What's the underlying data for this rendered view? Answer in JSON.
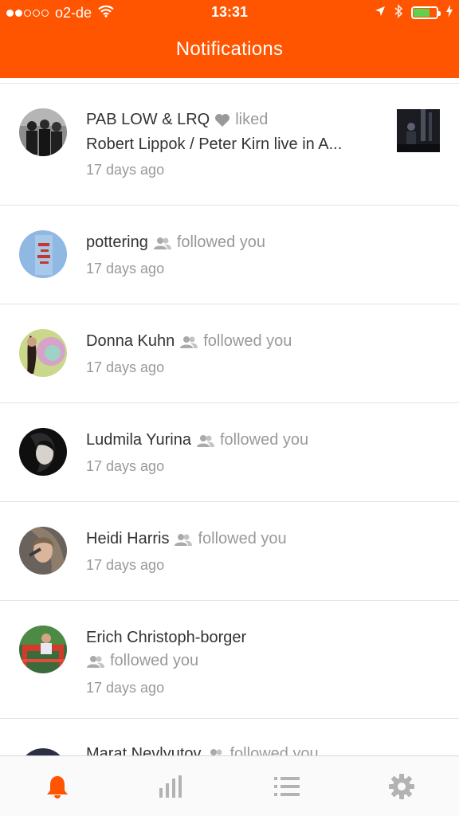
{
  "status_bar": {
    "carrier": "o2-de",
    "time": "13:31",
    "battery_level": 0.7,
    "colors": {
      "battery_fill": "#5ed14e"
    }
  },
  "nav": {
    "title": "Notifications"
  },
  "theme": {
    "accent": "#ff5500",
    "text": "#333333",
    "muted": "#999999"
  },
  "notifications": [
    {
      "name": "PAB LOW & LRQ",
      "action": "liked",
      "track": "Robert Lippok / Peter Kirn live in A...",
      "time": "17 days ago",
      "icon": "heart-icon"
    },
    {
      "name": "pottering",
      "action": "followed you",
      "time": "17 days ago",
      "icon": "followers-icon"
    },
    {
      "name": "Donna Kuhn",
      "action": "followed you",
      "time": "17 days ago",
      "icon": "followers-icon"
    },
    {
      "name": "Ludmila Yurina",
      "action": "followed you",
      "time": "17 days ago",
      "icon": "followers-icon"
    },
    {
      "name": "Heidi Harris",
      "action": "followed you",
      "time": "17 days ago",
      "icon": "followers-icon"
    },
    {
      "name": "Erich Christoph-borger",
      "action": "followed you",
      "time": "17 days ago",
      "icon": "followers-icon"
    },
    {
      "name": "Marat Nevlyutov",
      "action": "followed you",
      "icon": "followers-icon"
    }
  ],
  "tabs": [
    {
      "icon": "bell-icon",
      "active": true
    },
    {
      "icon": "stats-icon",
      "active": false
    },
    {
      "icon": "list-icon",
      "active": false
    },
    {
      "icon": "gear-icon",
      "active": false
    }
  ]
}
